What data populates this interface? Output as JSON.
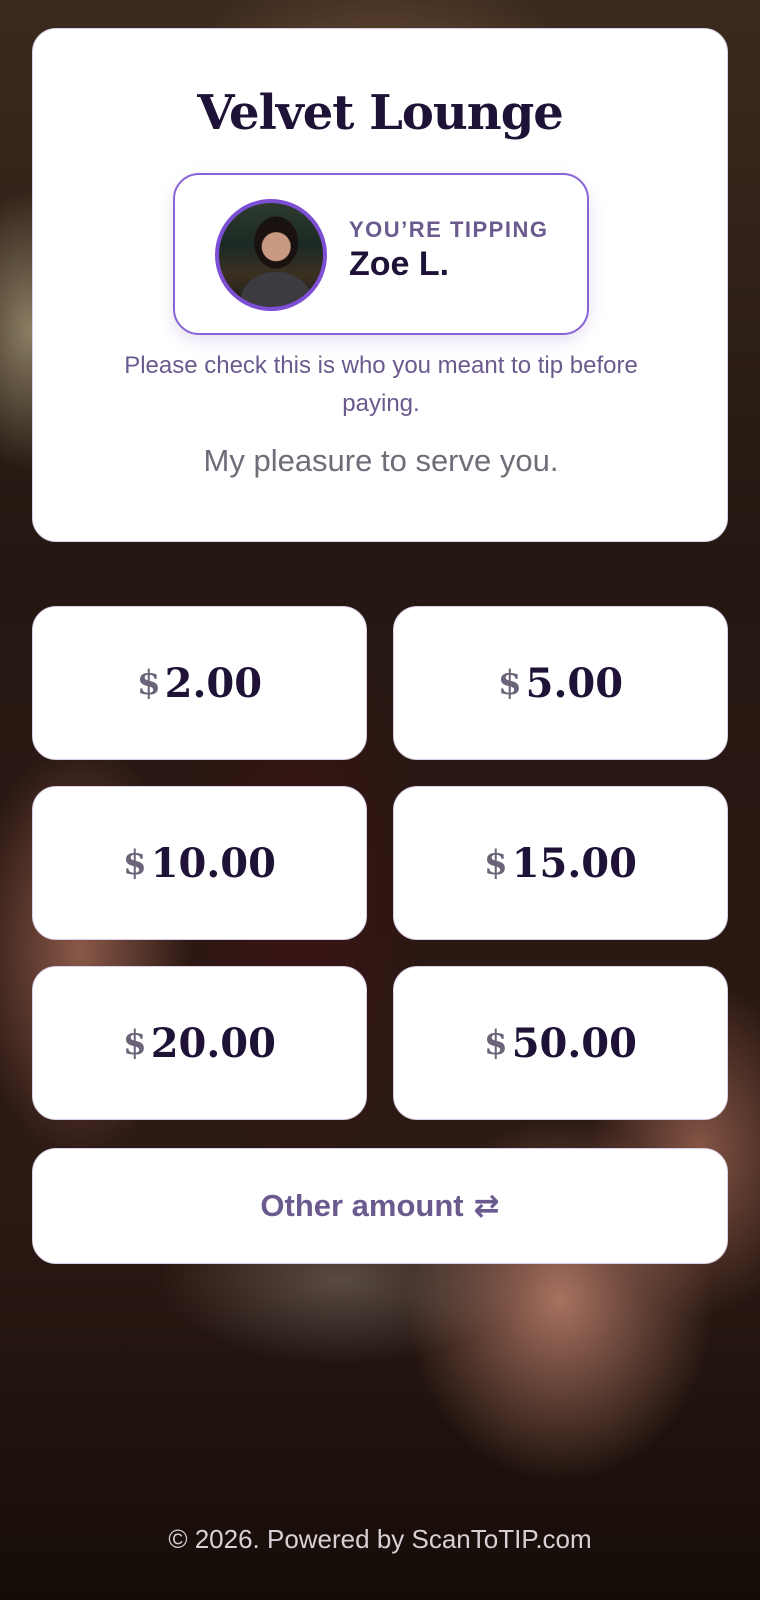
{
  "venue": {
    "name": "Velvet Lounge"
  },
  "staff": {
    "label": "YOU’RE TIPPING",
    "name": "Zoe L.",
    "check_note": "Please check this is who you meant to tip before paying.",
    "motto": "My pleasure to serve you."
  },
  "amounts": {
    "currency": "$",
    "options": [
      {
        "value": "2.00"
      },
      {
        "value": "5.00"
      },
      {
        "value": "10.00"
      },
      {
        "value": "15.00"
      },
      {
        "value": "20.00"
      },
      {
        "value": "50.00"
      }
    ]
  },
  "other": {
    "label": "Other amount",
    "icon": "⇄",
    "icon_name": "swap-icon"
  },
  "footer": {
    "text": "© 2026. Powered by ScanToTIP.com"
  },
  "colors": {
    "accent": "#7c4fd4",
    "text_dark": "#1e1236",
    "text_muted": "#6b5a8e"
  }
}
